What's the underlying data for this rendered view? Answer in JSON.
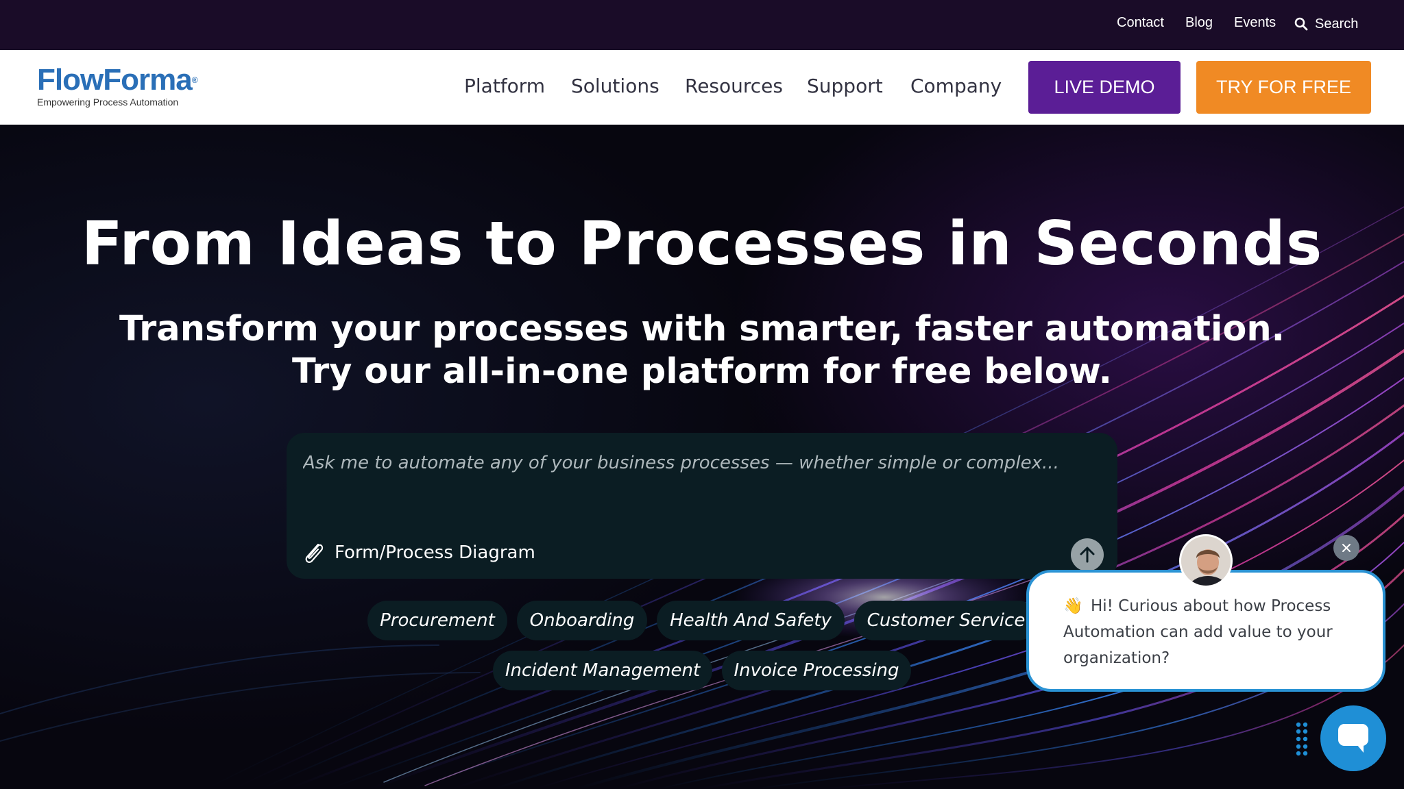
{
  "topbar": {
    "contact": "Contact",
    "blog": "Blog",
    "events": "Events",
    "search": "Search"
  },
  "logo": {
    "name": "FlowForma",
    "tagline": "Empowering Process Automation"
  },
  "nav": {
    "items": [
      "Platform",
      "Solutions",
      "Resources",
      "Support",
      "Company"
    ],
    "live_demo": "LIVE DEMO",
    "try_free": "TRY FOR FREE"
  },
  "hero": {
    "title": "From Ideas to Processes in Seconds",
    "subtitle_line1": "Transform your processes with smarter, faster automation.",
    "subtitle_line2": "Try our all-in-one platform for free below."
  },
  "prompt": {
    "placeholder": "Ask me to automate any of your business processes — whether simple or complex...",
    "attach_label": "Form/Process Diagram"
  },
  "chips": [
    "Procurement",
    "Onboarding",
    "Health And Safety",
    "Customer Service",
    "Incident Management",
    "Invoice Processing"
  ],
  "chat": {
    "message": "Hi! Curious about how Process Automation can add value to your organization?",
    "wave_emoji": "👋"
  },
  "colors": {
    "topbar_bg": "#1a0c28",
    "demo_button": "#5b1e96",
    "free_button": "#f08a24",
    "logo_blue": "#2a6fb7",
    "prompt_bg": "#0b1d23",
    "chat_blue": "#1f8fd6"
  }
}
